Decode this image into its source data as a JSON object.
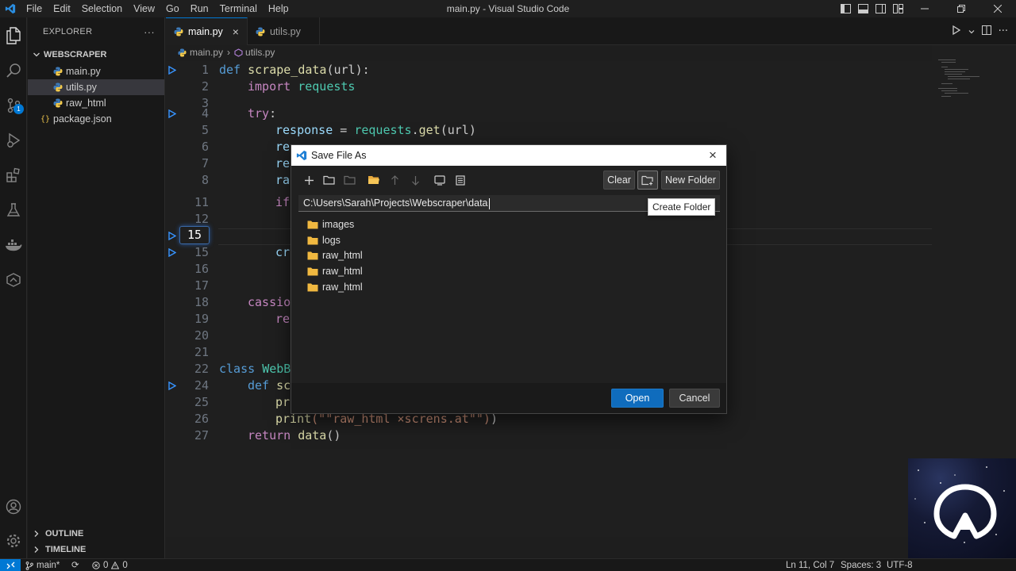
{
  "window": {
    "title": "main.py - Visual Studio Code",
    "menu": [
      "File",
      "Edit",
      "Selection",
      "View",
      "Go",
      "Run",
      "Terminal",
      "Help"
    ]
  },
  "activity_bar": {
    "icons": [
      "explorer-icon",
      "search-icon",
      "source-control-icon",
      "run-debug-icon",
      "extensions-icon",
      "testing-icon",
      "docker-icon",
      "remote-explorer-icon",
      "accounts-icon",
      "manage-gear-icon"
    ],
    "source_control_badge": "1"
  },
  "sidebar": {
    "header": "EXPLORER",
    "more": "···",
    "folder": "WEBSCRAPER",
    "files": [
      {
        "name": "main.py",
        "type": "python",
        "active": false
      },
      {
        "name": "utils.py",
        "type": "python",
        "active": true
      },
      {
        "name": "raw_html",
        "type": "python",
        "active": false
      },
      {
        "name": "package.json",
        "type": "json",
        "active": false
      }
    ],
    "outline": "OUTLINE",
    "timeline": "TIMELINE"
  },
  "tabs": [
    {
      "label": "main.py",
      "active": true,
      "close": "×"
    },
    {
      "label": "utils.py",
      "active": false
    }
  ],
  "breadcrumb": {
    "file": "main.py",
    "sep": "›",
    "symbol": "utils.py"
  },
  "editor": {
    "current_line": "15",
    "lines": [
      {
        "n": "1",
        "mark": true
      },
      {
        "n": "2"
      },
      {
        "n": "3"
      },
      {
        "n": "4",
        "mark": true
      },
      {
        "n": "5"
      },
      {
        "n": "6"
      },
      {
        "n": "7"
      },
      {
        "n": "8"
      },
      {
        "n": "11"
      },
      {
        "n": "12"
      },
      {
        "n": "15",
        "mark": true
      },
      {
        "n": "16"
      },
      {
        "n": "17"
      },
      {
        "n": "18"
      },
      {
        "n": "19"
      },
      {
        "n": "20"
      },
      {
        "n": "21"
      },
      {
        "n": "22"
      },
      {
        "n": "24",
        "mark": true
      },
      {
        "n": "25"
      },
      {
        "n": "26"
      },
      {
        "n": "27"
      }
    ],
    "code": {
      "l1_def": "def",
      "l1_fn": "scrape_data",
      "l1_rest": "(url):",
      "l2_kw": "import",
      "l2_mod": "requests",
      "l4_kw": "try",
      "l4_rest": ":",
      "l5_var": "response",
      "l5_op": " = ",
      "l5_mod": "requests",
      "l5_dot": ".",
      "l5_fn": "get",
      "l5_rest": "(url)",
      "l6": "re",
      "l7": "re",
      "l8": "ra",
      "l11": "if",
      "l15": "cr",
      "l18": "cassio",
      "l19": "re",
      "l22_kw": "class",
      "l22_rest": "WebB",
      "l24_kw": "def",
      "l24_rest": "sc",
      "l25": "pr",
      "l26_fn": "print",
      "l26_str": "(\"\"raw_html ×screns.at\"\")",
      "l26_rest": ")",
      "l27_kw": "return",
      "l27_fn": "data",
      "l27_rest": "()"
    }
  },
  "dialog": {
    "title": "Save File As",
    "close": "×",
    "toolbar_icons": [
      "new-file-icon",
      "new-folder-outline-icon",
      "folder-disabled-icon",
      "folder-open-icon",
      "arrow-up-icon",
      "arrow-down-icon",
      "screen-icon",
      "details-view-icon"
    ],
    "clear_label": "Clear",
    "create_folder_icon": "folder-plus-icon",
    "new_folder_label": "New Folder",
    "path": "C:\\Users\\Sarah\\Projects\\Webscraper\\data",
    "tooltip": "Create Folder",
    "entries": [
      "images",
      "logs",
      "raw_html",
      "raw_html",
      "raw_html"
    ],
    "open_label": "Open",
    "cancel_label": "Cancel"
  },
  "status_bar": {
    "branch": "main*",
    "sync": "⟳",
    "errors": "0",
    "warnings": "0",
    "position": "Ln 11, Col 7",
    "spaces": "Spaces: 3",
    "encoding": "UTF-8"
  },
  "colors": {
    "accent": "#0078d4",
    "editor_bg": "#1f1f1f",
    "sidebar_bg": "#181818",
    "dialog_bg": "#202020",
    "folder": "#f0b840",
    "keyword": "#569cd6",
    "function": "#dcdcaa",
    "module": "#4ec9b0"
  }
}
